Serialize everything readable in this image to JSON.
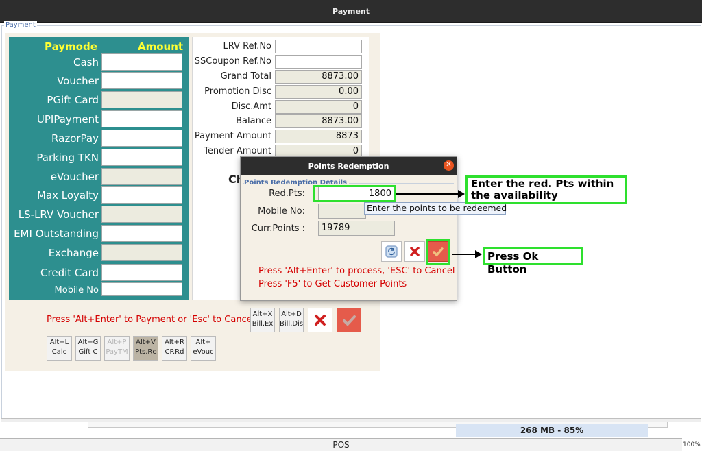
{
  "window": {
    "title": "Payment",
    "panel_title": "Payment"
  },
  "paymode": {
    "header_mode": "Paymode",
    "header_amount": "Amount",
    "rows": [
      {
        "label": "Cash",
        "enabled": true
      },
      {
        "label": "Voucher",
        "enabled": true
      },
      {
        "label": "PGift Card",
        "enabled": false
      },
      {
        "label": "UPIPayment",
        "enabled": true
      },
      {
        "label": "RazorPay",
        "enabled": true
      },
      {
        "label": "Parking TKN",
        "enabled": true
      },
      {
        "label": "eVoucher",
        "enabled": false
      },
      {
        "label": "Max Loyalty",
        "enabled": true
      },
      {
        "label": "LS-LRV Voucher",
        "enabled": false
      },
      {
        "label": "EMI Outstanding",
        "enabled": true
      },
      {
        "label": "Exchange",
        "enabled": false
      },
      {
        "label": "Credit Card",
        "enabled": true
      },
      {
        "label": "Mobile No",
        "enabled": true
      }
    ]
  },
  "summary": {
    "rows": [
      {
        "label": "LRV Ref.No",
        "value": ""
      },
      {
        "label": "SSCoupon Ref.No",
        "value": ""
      },
      {
        "label": "Grand Total",
        "value": "8873.00"
      },
      {
        "label": "Promotion Disc",
        "value": "0.00"
      },
      {
        "label": "Disc.Amt",
        "value": "0"
      },
      {
        "label": "Balance",
        "value": "8873.00"
      },
      {
        "label": "Payment Amount",
        "value": "8873"
      },
      {
        "label": "Tender Amount",
        "value": "0"
      }
    ],
    "partial_label": "Ch"
  },
  "footer": {
    "hint": "Press 'Alt+Enter' to Payment or 'Esc' to Cancel",
    "bill_buttons": [
      {
        "line1": "Alt+X",
        "line2": "Bill.Ex"
      },
      {
        "line1": "Alt+D",
        "line2": "Bill.Dis"
      }
    ],
    "shortcuts": [
      {
        "line1": "Alt+L",
        "line2": "Calc",
        "faded": false,
        "selected": false
      },
      {
        "line1": "Alt+G",
        "line2": "Gift C",
        "faded": false,
        "selected": false
      },
      {
        "line1": "Alt+P",
        "line2": "PayTM",
        "faded": true,
        "selected": false
      },
      {
        "line1": "Alt+V",
        "line2": "Pts.Rc",
        "faded": false,
        "selected": true
      },
      {
        "line1": "Alt+R",
        "line2": "CP.Rd",
        "faded": false,
        "selected": false
      },
      {
        "line1": "Alt+",
        "line2": "eVouc",
        "faded": false,
        "selected": false
      }
    ]
  },
  "dialog": {
    "title": "Points Redemption",
    "group": "Points Redemption Details",
    "red_pts_label": "Red.Pts:",
    "red_pts_value": "1800",
    "mobile_label": "Mobile No:",
    "mobile_value": "",
    "curr_points_label": "Curr.Points :",
    "curr_points_value": "19789",
    "tooltip": "Enter the points to be redeemed",
    "hint1": "Press 'Alt+Enter' to process, 'ESC' to Cancel",
    "hint2": "Press 'F5' to Get Customer Points"
  },
  "annotations": {
    "callout1": "Enter the red. Pts within the availability",
    "callout2": "Press Ok Button"
  },
  "status": {
    "app": "POS",
    "memory": "268 MB - 85%",
    "zoom": "100%"
  },
  "colors": {
    "paymode_bg": "#2d8f8f",
    "header_yellow": "#ffff33",
    "hint_red": "#d40000",
    "callout_green": "#2ee02e"
  }
}
